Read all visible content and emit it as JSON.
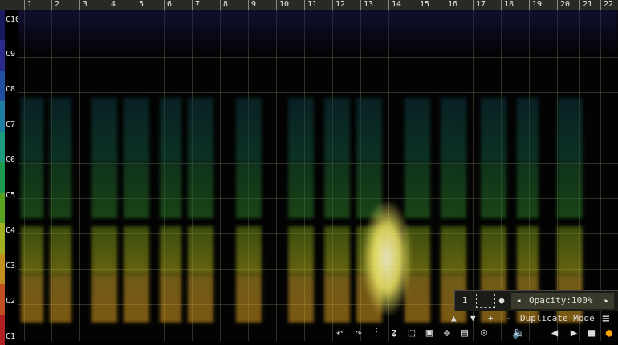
{
  "ruler": {
    "bars": [
      "1",
      "2",
      "3",
      "4",
      "5",
      "6",
      "7",
      "8",
      "9",
      "10",
      "11",
      "12",
      "13",
      "14",
      "15",
      "16",
      "17",
      "18",
      "19",
      "20",
      "21",
      "22"
    ]
  },
  "octaves": [
    "C10",
    "C9",
    "C8",
    "C7",
    "C6",
    "C5",
    "C4",
    "C3",
    "C2",
    "C1"
  ],
  "panel": {
    "num_label": "1",
    "opacity_label": "Opacity:100%",
    "up_arrow": "▲",
    "down_arrow": "▼",
    "plus": "+",
    "minus": "-",
    "mode_label": "Duplicate Mode",
    "menu_icon": "≡"
  },
  "colors": {
    "accent": "#e8c33a",
    "low": "#ffa500",
    "mid": "#b7d21c",
    "high": "#1f9a63",
    "top": "#2a2a8c"
  },
  "toolbar": {
    "icons": [
      "undo-icon",
      "redo-icon",
      "mixer-icon",
      "pitch-icon",
      "select-icon",
      "box-select-icon",
      "move-icon",
      "save-icon",
      "settings-icon",
      "volume-icon",
      "prev-icon",
      "play-icon",
      "stop-icon",
      "record-icon"
    ]
  }
}
